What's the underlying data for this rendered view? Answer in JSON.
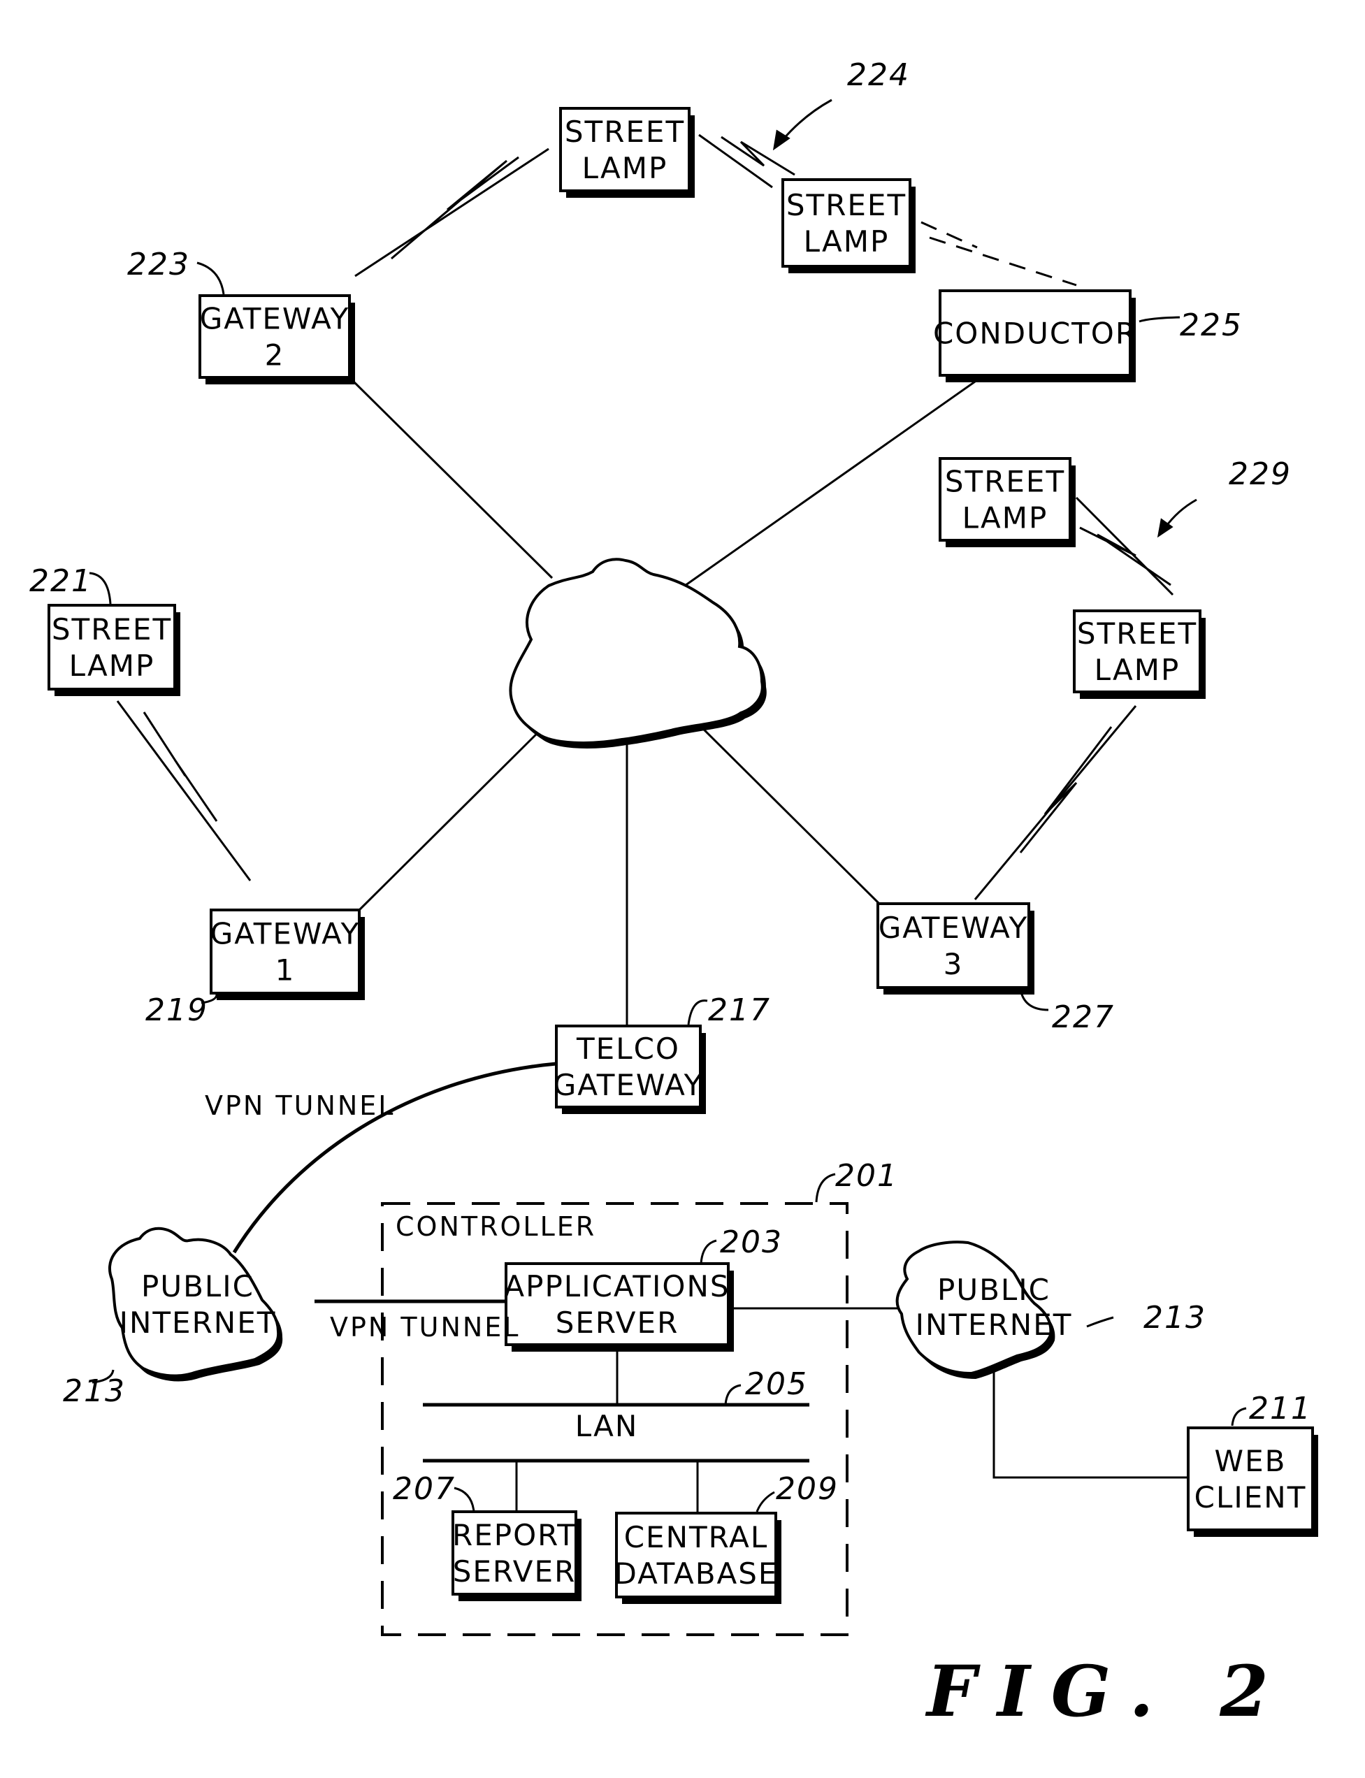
{
  "figure": {
    "label": "FIG. 2",
    "nodes": {
      "street_lamp_top": {
        "lines": [
          "STREET",
          "LAMP"
        ]
      },
      "street_lamp_224": {
        "lines": [
          "STREET",
          "LAMP"
        ]
      },
      "gateway_2": {
        "lines": [
          "GATEWAY",
          "2"
        ],
        "ref": "223"
      },
      "conductor": {
        "lines": [
          "CONDUCTOR"
        ],
        "ref": "225"
      },
      "street_lamp_229_top": {
        "lines": [
          "STREET",
          "LAMP"
        ]
      },
      "street_lamp_229_bottom": {
        "lines": [
          "STREET",
          "LAMP"
        ]
      },
      "street_lamp_221": {
        "lines": [
          "STREET",
          "LAMP"
        ],
        "ref": "221"
      },
      "gateway_1": {
        "lines": [
          "GATEWAY",
          "1"
        ],
        "ref": "219"
      },
      "gateway_3": {
        "lines": [
          "GATEWAY",
          "3"
        ],
        "ref": "227"
      },
      "telco_gateway": {
        "lines": [
          "TELCO",
          "GATEWAY"
        ],
        "ref": "217"
      },
      "public_internet_left": {
        "lines": [
          "PUBLIC",
          "INTERNET"
        ],
        "ref": "213"
      },
      "public_internet_right": {
        "lines": [
          "PUBLIC",
          "INTERNET"
        ],
        "ref": "213"
      },
      "controller": {
        "label": "CONTROLLER",
        "ref": "201"
      },
      "applications_server": {
        "lines": [
          "APPLICATIONS",
          "SERVER"
        ],
        "ref": "203"
      },
      "lan": {
        "label": "LAN",
        "ref": "205"
      },
      "report_server": {
        "lines": [
          "REPORT",
          "SERVER"
        ],
        "ref": "207"
      },
      "central_database": {
        "lines": [
          "CENTRAL",
          "DATABASE"
        ],
        "ref": "209"
      },
      "web_client": {
        "lines": [
          "WEB",
          "CLIENT"
        ],
        "ref": "211"
      }
    },
    "group_refs": {
      "lamp_group_top": "224",
      "lamp_group_right": "229"
    },
    "edge_labels": {
      "vpn_tunnel_upper": "VPN TUNNEL",
      "vpn_tunnel_lower": "VPN TUNNEL"
    },
    "connections": [
      {
        "from": "gateway_2",
        "to": "street_lamp_top",
        "type": "wireless"
      },
      {
        "from": "street_lamp_top",
        "to": "street_lamp_224",
        "type": "wireless"
      },
      {
        "from": "street_lamp_224",
        "to": "conductor",
        "type": "dashed"
      },
      {
        "from": "gateway_2",
        "to": "network_cloud",
        "type": "wired"
      },
      {
        "from": "conductor",
        "to": "network_cloud",
        "type": "wired"
      },
      {
        "from": "street_lamp_229_top",
        "to": "street_lamp_229_bottom",
        "type": "wireless"
      },
      {
        "from": "street_lamp_229_bottom",
        "to": "gateway_3",
        "type": "wireless"
      },
      {
        "from": "street_lamp_221",
        "to": "gateway_1",
        "type": "wireless"
      },
      {
        "from": "gateway_1",
        "to": "network_cloud",
        "type": "wired"
      },
      {
        "from": "gateway_3",
        "to": "network_cloud",
        "type": "wired"
      },
      {
        "from": "telco_gateway",
        "to": "network_cloud",
        "type": "wired"
      },
      {
        "from": "telco_gateway",
        "to": "public_internet_left",
        "type": "vpn"
      },
      {
        "from": "public_internet_left",
        "to": "applications_server",
        "type": "vpn"
      },
      {
        "from": "applications_server",
        "to": "public_internet_right",
        "type": "wired"
      },
      {
        "from": "applications_server",
        "to": "lan",
        "type": "wired"
      },
      {
        "from": "lan",
        "to": "report_server",
        "type": "wired"
      },
      {
        "from": "lan",
        "to": "central_database",
        "type": "wired"
      },
      {
        "from": "public_internet_right",
        "to": "web_client",
        "type": "wired"
      }
    ]
  }
}
